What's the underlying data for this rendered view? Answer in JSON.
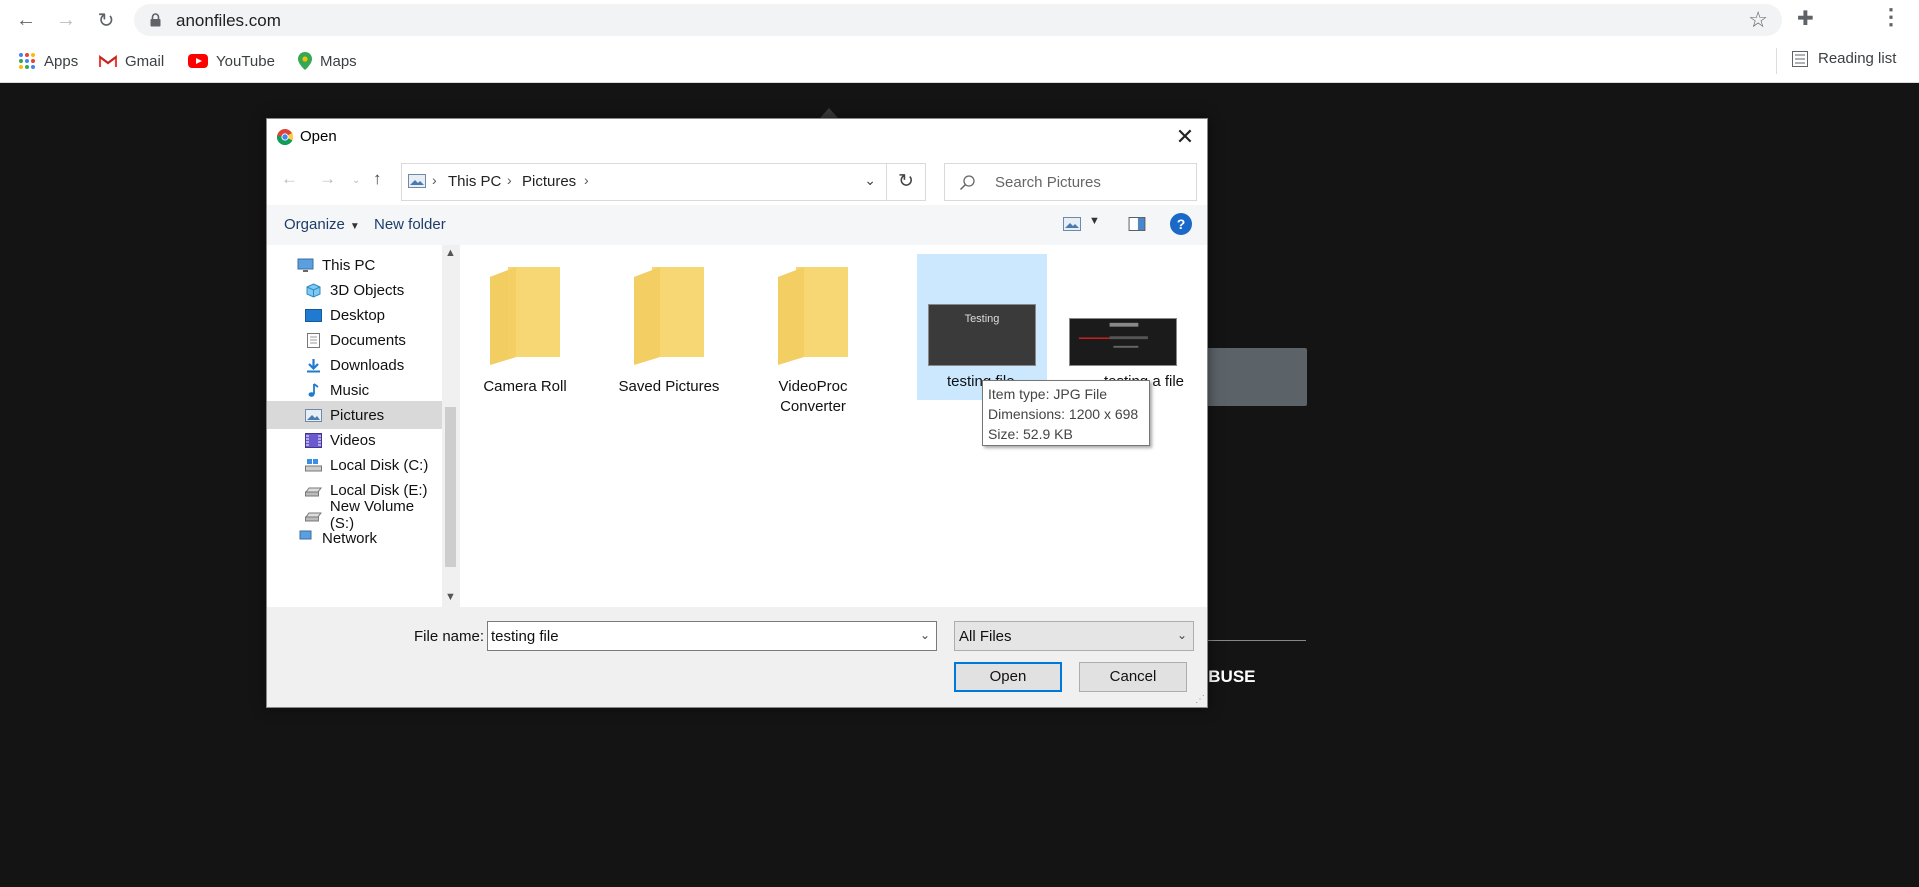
{
  "browser": {
    "url": "anonfiles.com",
    "bookmarks": [
      {
        "label": "Apps",
        "icon": "apps-grid-icon"
      },
      {
        "label": "Gmail",
        "icon": "gmail-icon"
      },
      {
        "label": "YouTube",
        "icon": "youtube-icon"
      },
      {
        "label": "Maps",
        "icon": "maps-pin-icon"
      }
    ],
    "reading_list": "Reading list"
  },
  "site": {
    "abuse_text": "ABUSE"
  },
  "dialog": {
    "title": "Open",
    "close_glyph": "✕",
    "breadcrumbs": [
      "This PC",
      "Pictures"
    ],
    "search_placeholder": "Search Pictures",
    "organize_label": "Organize",
    "new_folder_label": "New folder",
    "help_glyph": "?",
    "nav_items": [
      {
        "label": "This PC",
        "icon": "this-pc-icon"
      },
      {
        "label": "3D Objects",
        "icon": "3d-objects-icon"
      },
      {
        "label": "Desktop",
        "icon": "desktop-icon"
      },
      {
        "label": "Documents",
        "icon": "documents-icon"
      },
      {
        "label": "Downloads",
        "icon": "downloads-icon"
      },
      {
        "label": "Music",
        "icon": "music-icon"
      },
      {
        "label": "Pictures",
        "icon": "pictures-icon",
        "selected": true
      },
      {
        "label": "Videos",
        "icon": "videos-icon"
      },
      {
        "label": "Local Disk (C:)",
        "icon": "drive-icon"
      },
      {
        "label": "Local Disk (E:)",
        "icon": "drive-icon"
      },
      {
        "label": "New Volume (S:)",
        "icon": "drive-icon"
      },
      {
        "label": "Network",
        "icon": "network-icon"
      }
    ],
    "items": [
      {
        "label": "Camera Roll",
        "kind": "folder"
      },
      {
        "label": "Saved Pictures",
        "kind": "folder"
      },
      {
        "label": "VideoProc Converter",
        "kind": "folder"
      },
      {
        "label": "testing file",
        "kind": "image",
        "selected": true,
        "thumb_text": "Testing"
      },
      {
        "label": "testing a file",
        "kind": "image"
      }
    ],
    "tooltip": {
      "type": "Item type: JPG File",
      "dimensions": "Dimensions: 1200 x 698",
      "size": "Size: 52.9 KB"
    },
    "file_name_label": "File name:",
    "file_name_value": "testing file",
    "file_type_value": "All Files",
    "open_label": "Open",
    "cancel_label": "Cancel"
  }
}
